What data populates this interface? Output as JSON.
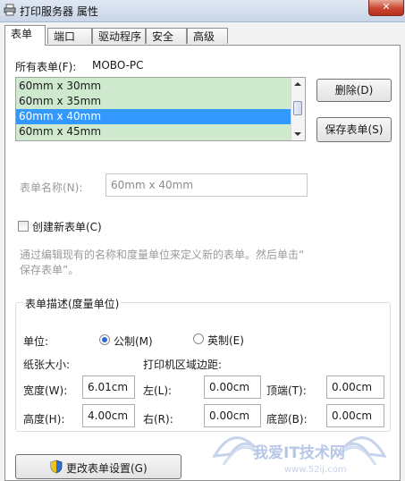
{
  "window": {
    "title": "打印服务器 属性",
    "close_glyph": "✕"
  },
  "tabs": [
    "表单",
    "端口",
    "驱动程序",
    "安全",
    "高级"
  ],
  "forms_list": {
    "label": "所有表单(F):",
    "server": "MOBO-PC",
    "items": [
      "60mm x 30mm",
      "60mm x 35mm",
      "60mm x 40mm",
      "60mm x 45mm"
    ],
    "selected": "60mm x 40mm"
  },
  "buttons": {
    "delete": "删除(D)",
    "save": "保存表单(S)",
    "change": "更改表单设置(G)"
  },
  "form_name": {
    "label": "表单名称(N):",
    "value": "60mm x 40mm"
  },
  "create_new": {
    "label": "创建新表单(C)",
    "checked": false
  },
  "description": {
    "line1": "通过编辑现有的名称和度量单位来定义新的表单。然后单击“",
    "line2": "保存表单”。"
  },
  "measurements": {
    "title": "表单描述(度量单位)",
    "unit_label": "单位:",
    "metric": "公制(M)",
    "english": "英制(E)",
    "selected_unit": "metric",
    "paper_size": "纸张大小:",
    "print_area": "打印机区域边距:",
    "width_label": "宽度(W):",
    "width": "6.01cm",
    "height_label": "高度(H):",
    "height": "4.00cm",
    "left_label": "左(L):",
    "left": "0.00cm",
    "right_label": "右(R):",
    "right": "0.00cm",
    "top_label": "顶端(T):",
    "top": "0.00cm",
    "bottom_label": "底部(B):",
    "bottom": "0.00cm"
  },
  "watermark": {
    "text": "我爱IT技术网",
    "url": "www.52ij.com"
  },
  "colors": {
    "list_bg": "#cfe9cf",
    "selection": "#3399ff",
    "radio_dot": "#2b6bd8",
    "close": "#c8452f"
  }
}
